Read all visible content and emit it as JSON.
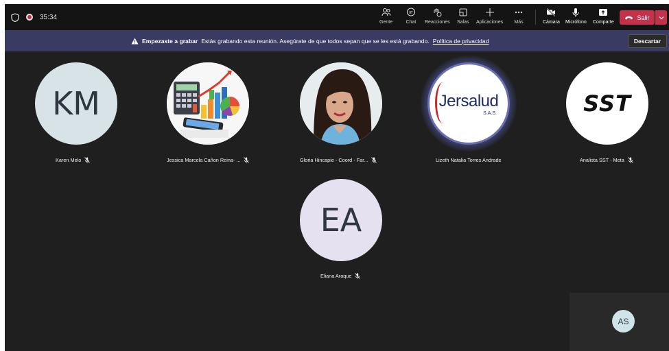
{
  "topbar": {
    "timer": "35:34",
    "buttons": {
      "people": "Gente",
      "chat": "Chat",
      "reactions": "Reacciones",
      "rooms": "Salas",
      "apps": "Aplicaciones",
      "more": "Más",
      "camera": "Cámara",
      "mic": "Micrófono",
      "share": "Comparte"
    },
    "leave": "Salir"
  },
  "banner": {
    "title": "Empezaste a grabar",
    "message": "Estás grabando esta reunión. Asegúrate de que todos sepan que se les está grabando.",
    "link": "Política de privacidad",
    "dismiss": "Descartar"
  },
  "participants": [
    {
      "initials": "KM",
      "name": "Karen Melo"
    },
    {
      "name": "Jessica Marcela Cañon Reina- ..."
    },
    {
      "name": "Gloria Hincapie - Coord - Far..."
    },
    {
      "logo_text": "Jersalud",
      "logo_sub": "S.A.S.",
      "name": "Lizeth Natalia Torres Andrade"
    },
    {
      "logo_text": "SST",
      "name": "Analista SST - Meta"
    },
    {
      "initials": "EA",
      "name": "Eliana Araque"
    }
  ],
  "self_view": {
    "initials": "AS"
  },
  "colors": {
    "stage": "#1f1f1f",
    "topbar": "#141414",
    "banner": "#3a3b63",
    "leave": "#c4314b",
    "avatar_km": "#d7e3e6",
    "avatar_ea": "#e6e1f0"
  }
}
